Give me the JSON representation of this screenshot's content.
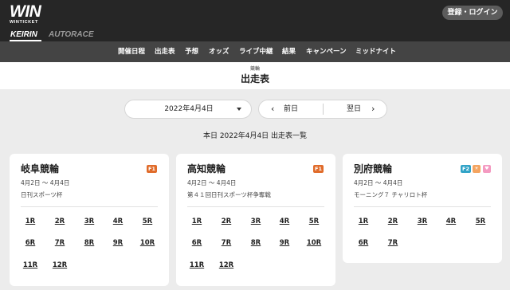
{
  "logo": {
    "main": "WIN",
    "sub": "WINTICKET"
  },
  "header": {
    "login_button": "登録・ログイン"
  },
  "sport_tabs": {
    "keirin": "KEIRIN",
    "autorace": "AUTORACE"
  },
  "nav": [
    "開催日程",
    "出走表",
    "予想",
    "オッズ",
    "ライブ中継",
    "結果",
    "キャンペーン",
    "ミッドナイト"
  ],
  "title": {
    "sub": "競輪",
    "main": "出走表"
  },
  "date_selector": {
    "value": "2022年4月4日"
  },
  "day_nav": {
    "prev": "前日",
    "next": "翌日"
  },
  "heading": "本日 2022年4月4日 出走表一覧",
  "cards": [
    {
      "name": "岐阜競輪",
      "dates": "4月2日 〜 4月4日",
      "race_title": "日刊スポーツ杯",
      "grade": "F1",
      "races": [
        "1R",
        "2R",
        "3R",
        "4R",
        "5R",
        "6R",
        "7R",
        "8R",
        "9R",
        "10R",
        "11R",
        "12R"
      ]
    },
    {
      "name": "高知競輪",
      "dates": "4月2日 〜 4月4日",
      "race_title": "第４１回日刊スポーツ杯争奪戦",
      "grade": "F1",
      "races": [
        "1R",
        "2R",
        "3R",
        "4R",
        "5R",
        "6R",
        "7R",
        "8R",
        "9R",
        "10R",
        "11R",
        "12R"
      ]
    },
    {
      "name": "別府競輪",
      "dates": "4月2日 〜 4月4日",
      "race_title": "モーニング７ チャリロト杯",
      "grade": "F2",
      "extra_badges": [
        "morning-icon",
        "girls-icon"
      ],
      "races": [
        "1R",
        "2R",
        "3R",
        "4R",
        "5R",
        "6R",
        "7R"
      ]
    }
  ],
  "colors": {
    "header_bg": "#262626",
    "nav_bg": "#444444",
    "page_bg": "#ececec",
    "f1_badge": "#e06b2a",
    "f2_badge": "#31a3c7"
  }
}
